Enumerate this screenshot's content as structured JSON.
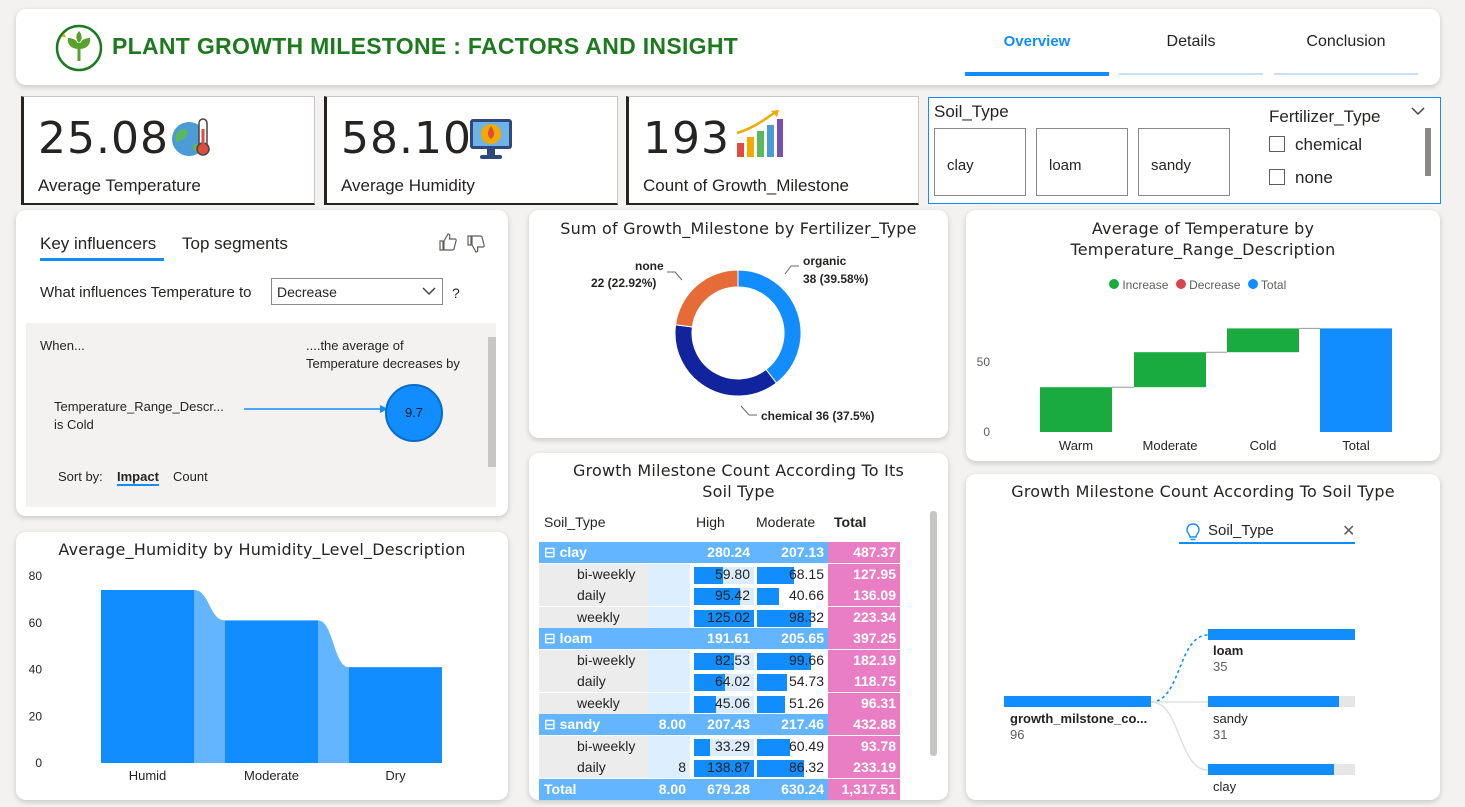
{
  "header": {
    "title": "PLANT GROWTH MILESTONE : FACTORS AND INSIGHT",
    "tabs": [
      {
        "label": "Overview",
        "active": true
      },
      {
        "label": "Details",
        "active": false
      },
      {
        "label": "Conclusion",
        "active": false
      }
    ],
    "brand_color": "#1e7a1e"
  },
  "kpis": [
    {
      "value": "25.08",
      "label": "Average Temperature",
      "icon": "globe-thermometer-icon"
    },
    {
      "value": "58.10",
      "label": "Average Humidity",
      "icon": "humidity-monitor-icon"
    },
    {
      "value": "193",
      "label": "Count of Growth_Milestone",
      "icon": "growth-bar-chart-icon"
    }
  ],
  "slicers": {
    "soil_type": {
      "title": "Soil_Type",
      "options": [
        "clay",
        "loam",
        "sandy"
      ]
    },
    "fertilizer_type": {
      "title": "Fertilizer_Type",
      "options": [
        "chemical",
        "none"
      ]
    }
  },
  "key_influencers": {
    "tabs": [
      "Key influencers",
      "Top segments"
    ],
    "question_prefix": "What influences Temperature to",
    "dropdown_value": "Decrease",
    "help": "?",
    "when": "When...",
    "result_header_1": "....the average of",
    "result_header_2": "Temperature decreases by",
    "influencer_line1": "Temperature_Range_Descr...",
    "influencer_line2": "is Cold",
    "bubble_value": "9.7",
    "sort_by": "Sort by:",
    "sort_impact": "Impact",
    "sort_count": "Count"
  },
  "donut": {
    "title": "Sum of Growth_Milestone by Fertilizer_Type",
    "labels": [
      {
        "name": "none",
        "text": "22 (22.92%)"
      },
      {
        "name": "organic",
        "text": "38 (39.58%)"
      },
      {
        "name": "chemical",
        "text": "chemical 36 (37.5%)"
      }
    ]
  },
  "waterfall": {
    "title_line1": "Average of Temperature by",
    "title_line2": "Temperature_Range_Description",
    "legend": [
      {
        "label": "Increase",
        "color": "#1aab40"
      },
      {
        "label": "Decrease",
        "color": "#d64550"
      },
      {
        "label": "Total",
        "color": "#118dff"
      }
    ]
  },
  "humidity": {
    "title": "Average_Humidity by Humidity_Level_Description"
  },
  "matrix": {
    "title_line1": "Growth Milestone Count According To Its",
    "title_line2": "Soil Type",
    "headers": [
      "Soil_Type",
      "High",
      "Moderate",
      "Total"
    ],
    "rows": [
      {
        "label": "⊟  clay",
        "low": "",
        "high": "280.24",
        "moderate": "207.13",
        "total": "487.37",
        "group": true
      },
      {
        "label": "bi-weekly",
        "low": "",
        "high": "59.80",
        "moderate": "68.15",
        "total": "127.95",
        "group": false,
        "hp": 0.48,
        "mp": 0.55
      },
      {
        "label": "daily",
        "low": "",
        "high": "95.42",
        "moderate": "40.66",
        "total": "136.09",
        "group": false,
        "hp": 0.76,
        "mp": 0.33
      },
      {
        "label": "weekly",
        "low": "",
        "high": "125.02",
        "moderate": "98.32",
        "total": "223.34",
        "group": false,
        "hp": 1.0,
        "mp": 0.79
      },
      {
        "label": "⊟  loam",
        "low": "",
        "high": "191.61",
        "moderate": "205.65",
        "total": "397.25",
        "group": true
      },
      {
        "label": "bi-weekly",
        "low": "",
        "high": "82.53",
        "moderate": "99.66",
        "total": "182.19",
        "group": false,
        "hp": 0.66,
        "mp": 0.8
      },
      {
        "label": "daily",
        "low": "",
        "high": "64.02",
        "moderate": "54.73",
        "total": "118.75",
        "group": false,
        "hp": 0.51,
        "mp": 0.44
      },
      {
        "label": "weekly",
        "low": "",
        "high": "45.06",
        "moderate": "51.26",
        "total": "96.31",
        "group": false,
        "hp": 0.36,
        "mp": 0.41
      },
      {
        "label": "⊟  sandy",
        "low": "8.00",
        "high": "207.43",
        "moderate": "217.46",
        "total": "432.88",
        "group": true
      },
      {
        "label": "bi-weekly",
        "low": "",
        "high": "33.29",
        "moderate": "60.49",
        "total": "93.78",
        "group": false,
        "hp": 0.27,
        "mp": 0.49
      },
      {
        "label": "daily",
        "low": "8",
        "high": "138.87",
        "moderate": "86.32",
        "total": "233.19",
        "group": false,
        "hp": 1.0,
        "mp": 0.69
      }
    ],
    "total_row": {
      "label": "Total",
      "low": "8.00",
      "high": "679.28",
      "moderate": "630.24",
      "total": "1,317.51"
    }
  },
  "decomposition": {
    "title": "Growth Milestone Count According To Soil Type",
    "field": "Soil_Type",
    "root": {
      "label": "growth_milstone_co...",
      "value": "96"
    },
    "children": [
      {
        "label": "loam",
        "value": "35",
        "fraction": 1.0
      },
      {
        "label": "sandy",
        "value": "31",
        "fraction": 0.89
      },
      {
        "label": "clay",
        "value": "",
        "fraction": 0.86
      }
    ]
  },
  "chart_data": [
    {
      "type": "pie",
      "title": "Sum of Growth_Milestone by Fertilizer_Type",
      "categories": [
        "organic",
        "chemical",
        "none"
      ],
      "values": [
        38,
        36,
        22
      ],
      "colors": [
        "#118dff",
        "#12239e",
        "#e66c37"
      ]
    },
    {
      "type": "bar",
      "subtype": "waterfall",
      "title": "Average of Temperature by Temperature_Range_Description",
      "categories": [
        "Warm",
        "Moderate",
        "Cold",
        "Total"
      ],
      "values": [
        32,
        25,
        17,
        74
      ],
      "ylim": [
        0,
        80
      ],
      "yticks": [
        0,
        50
      ]
    },
    {
      "type": "area",
      "subtype": "ribbon",
      "title": "Average_Humidity by Humidity_Level_Description",
      "categories": [
        "Humid",
        "Moderate",
        "Dry"
      ],
      "values": [
        74,
        61,
        41
      ],
      "ylim": [
        0,
        80
      ],
      "yticks": [
        0,
        20,
        40,
        60,
        80
      ]
    }
  ]
}
